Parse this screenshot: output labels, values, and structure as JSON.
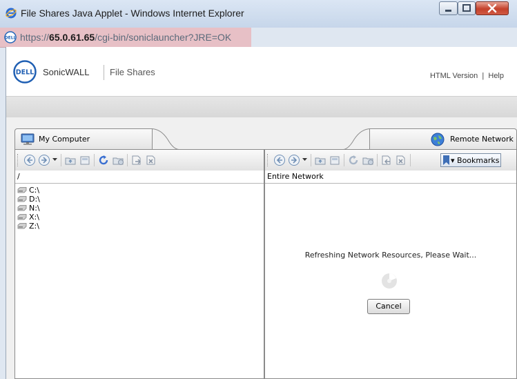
{
  "window": {
    "title": "File Shares Java Applet - Windows Internet Explorer",
    "address_prefix": "https://",
    "address_host": "65.0.61.65",
    "address_path": "/cgi-bin/soniclauncher?JRE=OK"
  },
  "header": {
    "logo_text": "DELL",
    "brand": "SonicWALL",
    "product": "File Shares",
    "html_version": "HTML Version",
    "separator": "|",
    "help": "Help"
  },
  "left_panel": {
    "tab_label": "My Computer",
    "path": "/",
    "drives": [
      "C:\\",
      "D:\\",
      "N:\\",
      "X:\\",
      "Z:\\"
    ]
  },
  "right_panel": {
    "tab_label": "Remote Network",
    "path": "Entire Network",
    "bookmarks_label": "Bookmarks",
    "status_message": "Refreshing Network Resources, Please Wait...",
    "cancel_label": "Cancel"
  },
  "colors": {
    "address_bar_bg": "#e7c0c6",
    "close_button": "#c4412b",
    "toolbar_icon_blue": "#6f8fb5",
    "refresh_icon": "#3a6fd1"
  },
  "icons": {
    "ie": "internet-explorer-icon",
    "dell_site": "dell-site-icon",
    "computer": "computer-icon",
    "globe": "globe-icon",
    "back": "back-icon",
    "forward": "forward-icon",
    "up": "up-folder-icon",
    "new_folder": "new-folder-icon",
    "refresh": "refresh-icon",
    "upload": "upload-icon",
    "rename": "rename-icon",
    "delete": "delete-icon",
    "drive": "drive-icon",
    "bookmark": "bookmark-icon",
    "spinner": "loading-spinner-icon"
  }
}
